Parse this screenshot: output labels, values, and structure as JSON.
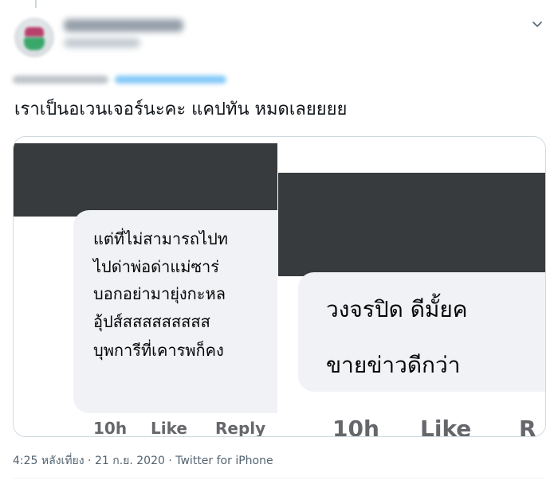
{
  "tweet": {
    "text": "เราเป็นอเวนเจอร์นะคะ แคปทัน หมดเลยยยย",
    "timestamp": "4:25 หลังเที่ยง",
    "date": "21 ก.ย. 2020",
    "separator": "·",
    "source": "Twitter for iPhone"
  },
  "screenshot_left": {
    "lines": [
      "แต่ที่ไม่สามารถไปท",
      "ไปด่าพ่อด่าแม่ซาร่",
      "บอกอย่ามายุ่งกะหล",
      "อุ้ปส์สสสสสสสสส",
      "บุพการีที่เคารพก็คง"
    ],
    "time": "10h",
    "like": "Like",
    "reply": "Reply"
  },
  "screenshot_right": {
    "lines": [
      "วงจรปิด ดีมั้ยค",
      "ขายข่าวดีกว่า"
    ],
    "time": "10h",
    "like": "Like",
    "reply": "R"
  },
  "icons": {
    "caret": "chevron-down-icon"
  },
  "colors": {
    "text_primary": "#0f1419",
    "text_secondary": "#536471",
    "redaction": "#373b3e",
    "comment_bubble": "#f0f2f5",
    "link_blue": "#1d9bf0"
  }
}
